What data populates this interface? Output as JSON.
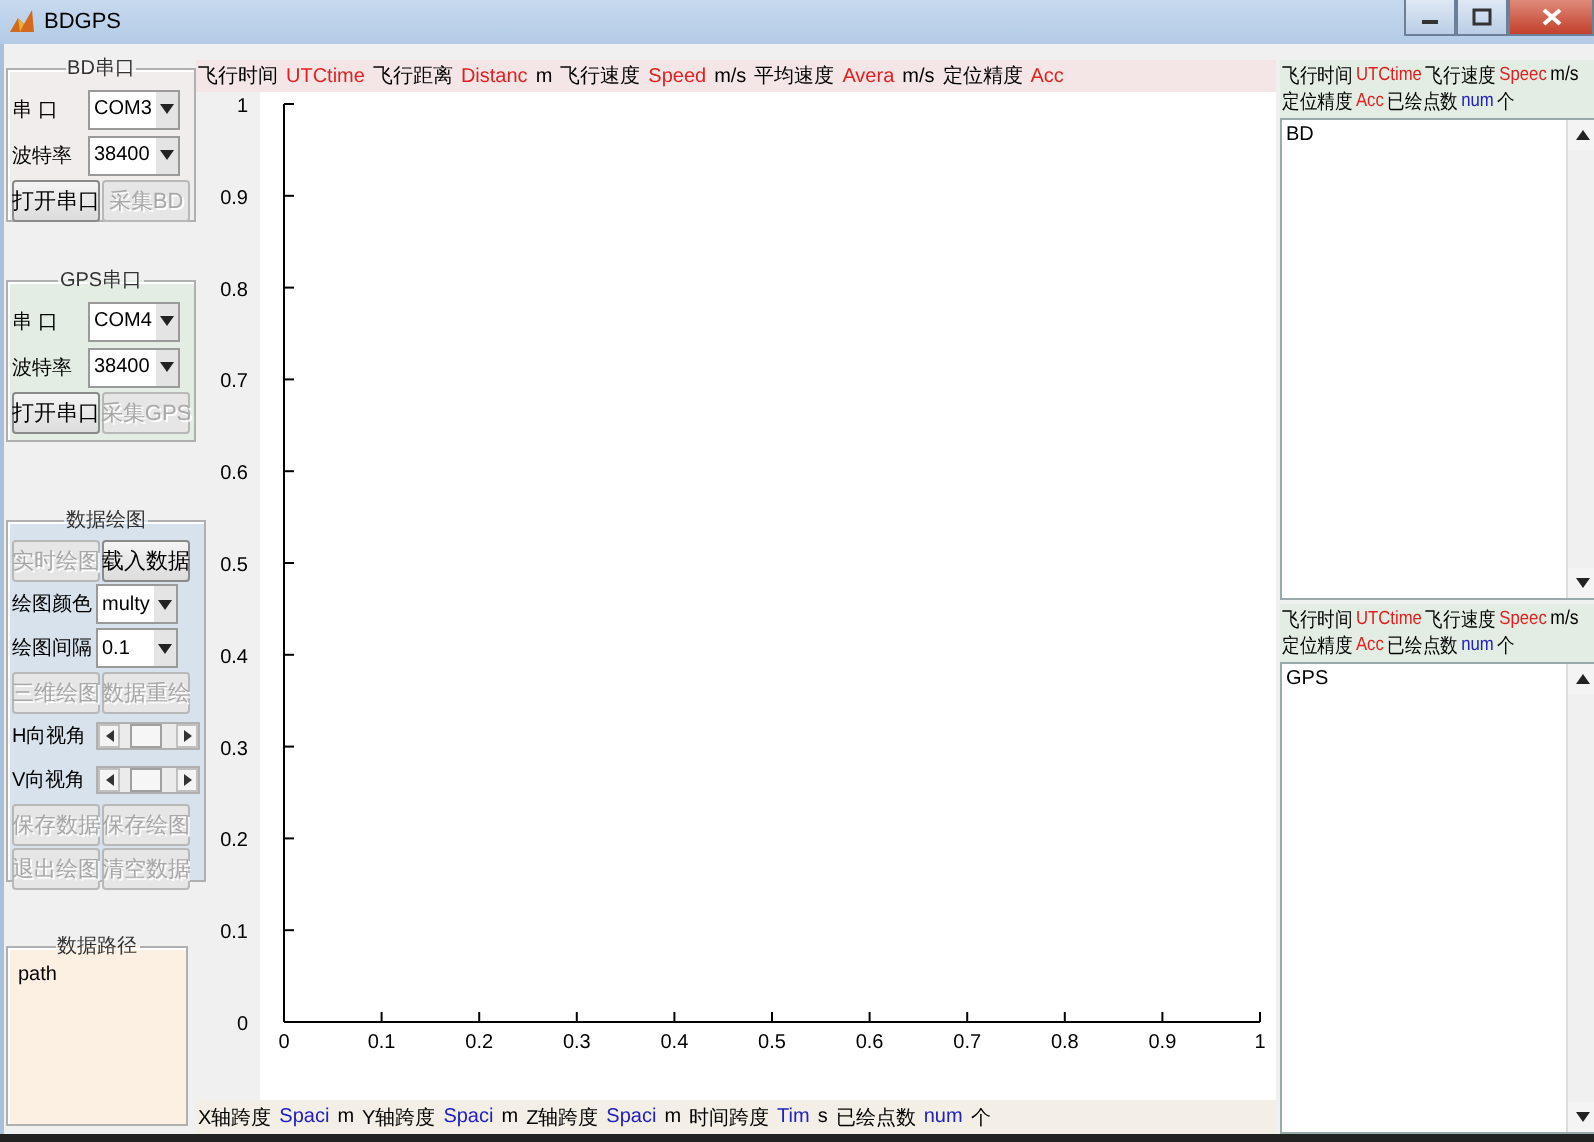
{
  "window": {
    "title": "BDGPS"
  },
  "bd_port": {
    "title": "BD串口",
    "port_label": "串 口",
    "port_value": "COM3",
    "baud_label": "波特率",
    "baud_value": "38400",
    "buttons": [
      {
        "label": "打开串口",
        "disabled": false
      },
      {
        "label": "采集BD",
        "disabled": true
      }
    ]
  },
  "gps_port": {
    "title": "GPS串口",
    "port_label": "串 口",
    "port_value": "COM4",
    "baud_label": "波特率",
    "baud_value": "38400",
    "buttons": [
      {
        "label": "打开串口",
        "disabled": false
      },
      {
        "label": "采集GPS",
        "disabled": true
      }
    ]
  },
  "plotting": {
    "title": "数据绘图",
    "items": [
      {
        "kind": "buttons",
        "buttons": [
          {
            "label": "实时绘图",
            "disabled": true
          },
          {
            "label": "载入数据",
            "disabled": false
          }
        ]
      },
      {
        "kind": "dropdown",
        "label": "绘图颜色",
        "value": "multy"
      },
      {
        "kind": "dropdown",
        "label": "绘图间隔",
        "value": "0.1"
      },
      {
        "kind": "buttons",
        "buttons": [
          {
            "label": "三维绘图",
            "disabled": true
          },
          {
            "label": "数据重绘",
            "disabled": true
          }
        ]
      },
      {
        "kind": "slider",
        "label": "H向视角",
        "level": 0.45
      },
      {
        "kind": "slider",
        "label": "V向视角",
        "level": 0.45
      },
      {
        "kind": "buttons",
        "buttons": [
          {
            "label": "保存数据",
            "disabled": true
          },
          {
            "label": "保存绘图",
            "disabled": true
          }
        ]
      },
      {
        "kind": "buttons",
        "buttons": [
          {
            "label": "退出绘图",
            "disabled": true
          },
          {
            "label": "清空数据",
            "disabled": true
          }
        ]
      }
    ]
  },
  "data_path": {
    "title": "数据路径",
    "value": "path"
  },
  "top_status": [
    {
      "kind": "label",
      "text": "飞行时间"
    },
    {
      "kind": "value",
      "text": "UTCtime",
      "color": "#e02020"
    },
    {
      "kind": "label",
      "text": "飞行距离"
    },
    {
      "kind": "value",
      "text": "Distanc",
      "color": "#e02020"
    },
    {
      "kind": "label",
      "text": "m"
    },
    {
      "kind": "label",
      "text": "飞行速度"
    },
    {
      "kind": "value",
      "text": "Speed",
      "color": "#e02020"
    },
    {
      "kind": "label",
      "text": "m/s"
    },
    {
      "kind": "label",
      "text": "平均速度"
    },
    {
      "kind": "value",
      "text": "Avera",
      "color": "#e02020"
    },
    {
      "kind": "label",
      "text": "m/s"
    },
    {
      "kind": "label",
      "text": "定位精度"
    },
    {
      "kind": "value",
      "text": "Acc",
      "color": "#e02020"
    }
  ],
  "plot": {
    "chart_data": {
      "type": "line",
      "xlim": [
        0,
        1
      ],
      "ylim": [
        0,
        1
      ],
      "xticks": [
        0,
        0.1,
        0.2,
        0.3,
        0.4,
        0.5,
        0.6,
        0.7,
        0.8,
        0.9,
        1
      ],
      "yticks": [
        0,
        0.1,
        0.2,
        0.3,
        0.4,
        0.5,
        0.6,
        0.7,
        0.8,
        0.9,
        1
      ]
    }
  },
  "bottom_status": [
    {
      "kind": "label",
      "text": "X轴跨度"
    },
    {
      "kind": "value",
      "text": "Spaci",
      "color": "#2020c0"
    },
    {
      "kind": "label",
      "text": "m"
    },
    {
      "kind": "label",
      "text": "Y轴跨度"
    },
    {
      "kind": "value",
      "text": "Spaci",
      "color": "#2020c0"
    },
    {
      "kind": "label",
      "text": "m"
    },
    {
      "kind": "label",
      "text": "Z轴跨度"
    },
    {
      "kind": "value",
      "text": "Spaci",
      "color": "#2020c0"
    },
    {
      "kind": "label",
      "text": "m"
    },
    {
      "kind": "label",
      "text": "时间跨度"
    },
    {
      "kind": "value",
      "text": "Tim",
      "color": "#2020c0"
    },
    {
      "kind": "label",
      "text": "s"
    },
    {
      "kind": "label",
      "text": "已绘点数"
    },
    {
      "kind": "value",
      "text": "num",
      "color": "#2020c0"
    },
    {
      "kind": "label",
      "text": "个"
    }
  ],
  "monitors": [
    {
      "lines": [
        [
          {
            "kind": "label",
            "text": "飞行时间"
          },
          {
            "kind": "value",
            "text": "UTCtime",
            "color": "#e02020"
          },
          {
            "kind": "label",
            "text": "飞行速度"
          },
          {
            "kind": "value",
            "text": "Speec",
            "color": "#e02020"
          },
          {
            "kind": "label",
            "text": "m/s"
          }
        ],
        [
          {
            "kind": "label",
            "text": "定位精度"
          },
          {
            "kind": "value",
            "text": "Acc",
            "color": "#e02020"
          },
          {
            "kind": "label",
            "text": "已绘点数"
          },
          {
            "kind": "value",
            "text": "num",
            "color": "#2020c0"
          },
          {
            "kind": "label",
            "text": "个"
          }
        ]
      ],
      "list_items": [
        "BD"
      ]
    },
    {
      "lines": [
        [
          {
            "kind": "label",
            "text": "飞行时间"
          },
          {
            "kind": "value",
            "text": "UTCtime",
            "color": "#e02020"
          },
          {
            "kind": "label",
            "text": "飞行速度"
          },
          {
            "kind": "value",
            "text": "Speec",
            "color": "#e02020"
          },
          {
            "kind": "label",
            "text": "m/s"
          }
        ],
        [
          {
            "kind": "label",
            "text": "定位精度"
          },
          {
            "kind": "value",
            "text": "Acc",
            "color": "#e02020"
          },
          {
            "kind": "label",
            "text": "已绘点数"
          },
          {
            "kind": "value",
            "text": "num",
            "color": "#2020c0"
          },
          {
            "kind": "label",
            "text": "个"
          }
        ]
      ],
      "list_items": [
        "GPS"
      ]
    }
  ]
}
